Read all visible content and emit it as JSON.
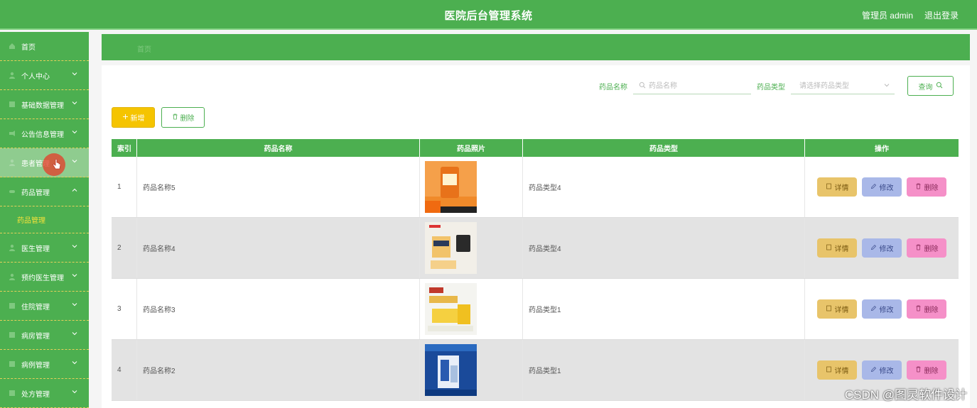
{
  "header": {
    "title": "医院后台管理系统",
    "admin_label": "管理员 admin",
    "logout_label": "退出登录"
  },
  "sidebar": {
    "items": [
      {
        "label": "首页",
        "icon": "home-icon"
      },
      {
        "label": "个人中心",
        "icon": "user-icon"
      },
      {
        "label": "基础数据管理",
        "icon": "data-icon"
      },
      {
        "label": "公告信息管理",
        "icon": "notice-icon"
      },
      {
        "label": "患者管理",
        "icon": "patient-icon"
      },
      {
        "label": "药品管理",
        "icon": "drug-icon"
      },
      {
        "label": "医生管理",
        "icon": "doctor-icon"
      },
      {
        "label": "预约医生管理",
        "icon": "appointment-icon"
      },
      {
        "label": "住院管理",
        "icon": "hospital-icon"
      },
      {
        "label": "病房管理",
        "icon": "ward-icon"
      },
      {
        "label": "病例管理",
        "icon": "case-icon"
      },
      {
        "label": "处方管理",
        "icon": "prescription-icon"
      }
    ],
    "submenu": {
      "label": "药品管理"
    }
  },
  "breadcrumb": {
    "current": "首页"
  },
  "search": {
    "name_label": "药品名称",
    "name_placeholder": "药品名称",
    "type_label": "药品类型",
    "type_placeholder": "请选择药品类型",
    "query_label": "查询"
  },
  "actions": {
    "add_label": "新增",
    "delete_label": "删除"
  },
  "table": {
    "columns": [
      "索引",
      "药品名称",
      "药品照片",
      "药品类型",
      "操作"
    ],
    "op_detail": "详情",
    "op_edit": "修改",
    "op_delete": "删除",
    "rows": [
      {
        "index": "1",
        "name": "药品名称5",
        "type": "药品类型4"
      },
      {
        "index": "2",
        "name": "药品名称4",
        "type": "药品类型4"
      },
      {
        "index": "3",
        "name": "药品名称3",
        "type": "药品类型1"
      },
      {
        "index": "4",
        "name": "药品名称2",
        "type": "药品类型1"
      }
    ]
  },
  "watermark": "CSDN @图灵软件设计",
  "colors": {
    "primary": "#4caf50",
    "accent_yellow": "#f5c400",
    "detail_btn": "#e8c46a",
    "edit_btn": "#a9b8e8",
    "delete_btn": "#f590c8"
  }
}
